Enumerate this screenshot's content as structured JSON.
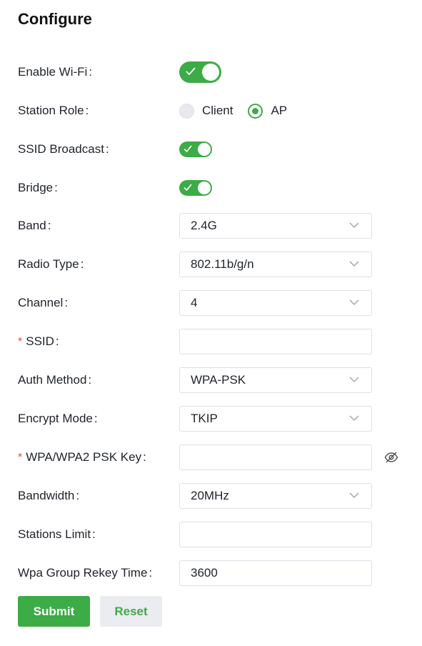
{
  "title": "Configure",
  "colon": ":",
  "form": {
    "enable_wifi": {
      "label": "Enable Wi-Fi",
      "on": true
    },
    "station_role": {
      "label": "Station Role",
      "options": [
        "Client",
        "AP"
      ],
      "selected": "AP"
    },
    "ssid_broadcast": {
      "label": "SSID Broadcast",
      "on": true
    },
    "bridge": {
      "label": "Bridge",
      "on": true
    },
    "band": {
      "label": "Band",
      "value": "2.4G"
    },
    "radio_type": {
      "label": "Radio Type",
      "value": "802.11b/g/n"
    },
    "channel": {
      "label": "Channel",
      "value": "4"
    },
    "ssid": {
      "label": "SSID",
      "required": "*",
      "value": ""
    },
    "auth_method": {
      "label": "Auth Method",
      "value": "WPA-PSK"
    },
    "encrypt_mode": {
      "label": "Encrypt Mode",
      "value": "TKIP"
    },
    "psk_key": {
      "label": "WPA/WPA2 PSK Key",
      "required": "*",
      "value": "",
      "icon": "eye-hidden-icon"
    },
    "bandwidth": {
      "label": "Bandwidth",
      "value": "20MHz"
    },
    "stations_limit": {
      "label": "Stations Limit",
      "value": ""
    },
    "wpa_group_rekey_time": {
      "label": "Wpa Group Rekey Time",
      "value": "3600"
    }
  },
  "buttons": {
    "submit": "Submit",
    "reset": "Reset"
  },
  "colors": {
    "accent": "#3dab46",
    "required": "#e5484d"
  }
}
